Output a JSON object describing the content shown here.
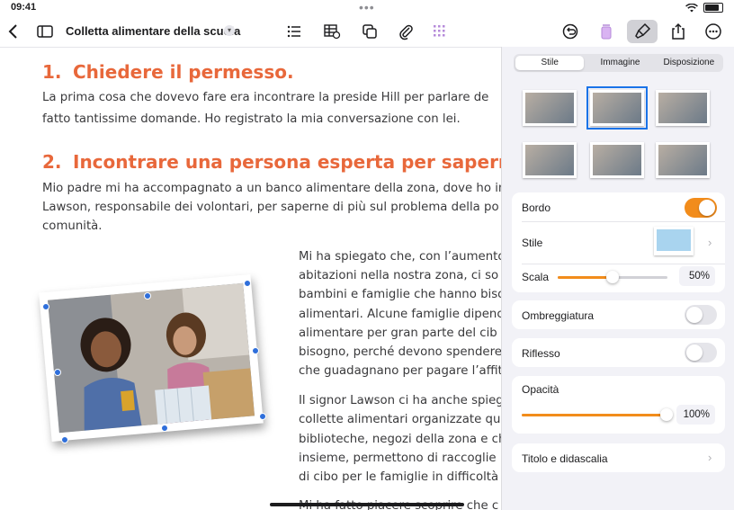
{
  "status": {
    "time": "09:41"
  },
  "toolbar": {
    "doc_title": "Colletta alimentare della scuola"
  },
  "document": {
    "heading1": {
      "num": "1.",
      "text": "Chiedere il permesso."
    },
    "para1": [
      "La prima cosa che dovevo fare era incontrare la preside Hill per parlare de",
      "fatto tantissime domande. Ho registrato la mia conversazione con lei."
    ],
    "heading2": {
      "num": "2.",
      "text": "Incontrare una persona esperta per saperne d"
    },
    "para2": [
      "Mio padre mi ha accompagnato a un banco alimentare della zona, dove ho in",
      "Lawson, responsabile dei volontari, per saperne di più sul problema della po",
      "comunità."
    ],
    "para3": [
      "Mi ha spiegato che, con l’aumento",
      "abitazioni nella nostra zona, ci so",
      "bambini e famiglie che hanno biso",
      "alimentari. Alcune famiglie dipenc",
      "alimentare per gran parte del cib",
      "bisogno, perché devono spendere",
      "che guadagnano per pagare l’affit"
    ],
    "para4": [
      "Il signor Lawson ci ha anche spieg",
      "collette alimentari organizzate qu",
      "biblioteche, negozi della zona e ch",
      "insieme, permettono di raccoglie",
      "di cibo per le famiglie in difficoltà",
      "Mi ha fatto piacere scoprire che c"
    ]
  },
  "panel": {
    "tabs": [
      "Stile",
      "Immagine",
      "Disposizione"
    ],
    "border": {
      "label": "Bordo",
      "on": true
    },
    "style": {
      "label": "Stile"
    },
    "scale": {
      "label": "Scala",
      "value": "50%",
      "fraction": 0.5
    },
    "shadow": {
      "label": "Ombreggiatura",
      "on": false
    },
    "reflection": {
      "label": "Riflesso",
      "on": false
    },
    "opacity": {
      "label": "Opacità",
      "value": "100%",
      "fraction": 1.0
    },
    "caption": {
      "label": "Titolo e didascalia"
    }
  },
  "colors": {
    "accent": "#f28c1b",
    "heading": "#e8683b",
    "selection": "#2f6fdb"
  }
}
